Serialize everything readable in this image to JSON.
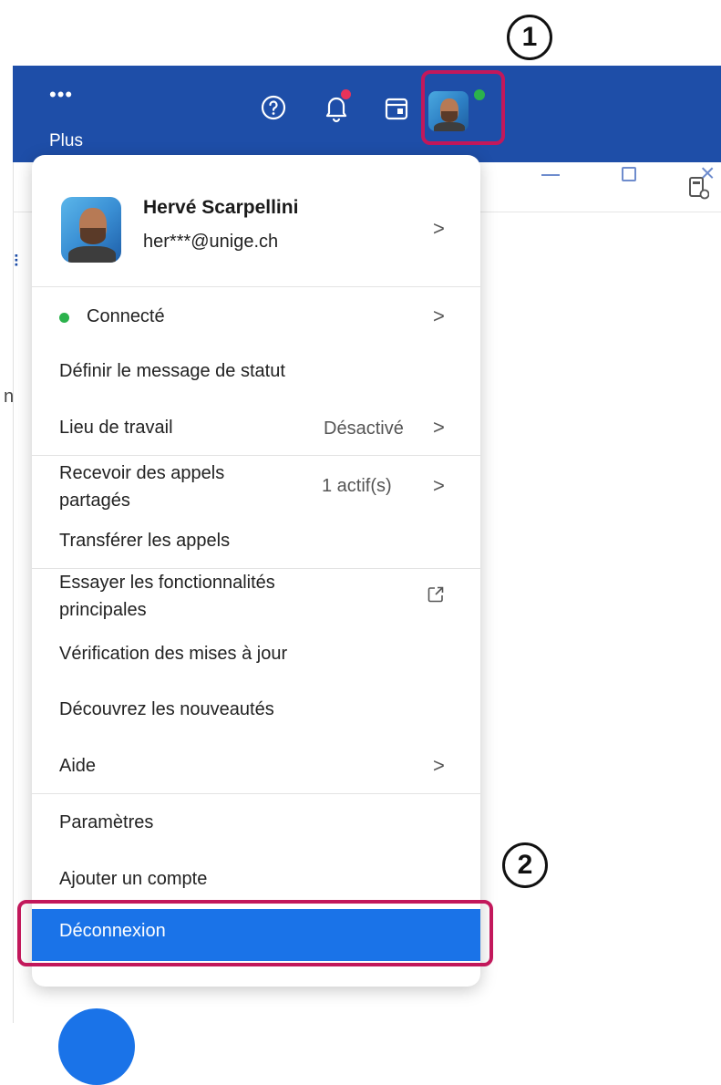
{
  "titlebar": {
    "more_label": "Plus",
    "more_glyph": "•••",
    "help_icon": "question-circle-icon",
    "notifications_icon": "bell-icon",
    "calendar_icon": "calendar-icon",
    "accent_color": "#1e4ea8",
    "close_glyph": "×"
  },
  "annotations": {
    "step1": "1",
    "step2": "2",
    "highlight_color": "#c2185b"
  },
  "profile": {
    "name": "Hervé Scarpellini",
    "email": "her***@unige.ch"
  },
  "menu": {
    "status": "Connecté",
    "status_color": "#2bb24c",
    "set_status_message": "Définir le message de statut",
    "work_location": "Lieu de travail",
    "work_location_value": "Désactivé",
    "shared_calls_line1": "Recevoir des appels",
    "shared_calls_line2": "partagés",
    "shared_calls_value": "1 actif(s)",
    "forward_calls": "Transférer les appels",
    "try_features_line1": "Essayer les fonctionnalités",
    "try_features_line2": "principales",
    "check_updates": "Vérification des mises à jour",
    "whats_new": "Découvrez les nouveautés",
    "help": "Aide",
    "settings": "Paramètres",
    "add_account": "Ajouter un compte",
    "sign_out": "Déconnexion",
    "sign_out_color": "#1a73e8"
  },
  "misc": {
    "stray_text": "n",
    "grid_glyph": "⠇"
  }
}
